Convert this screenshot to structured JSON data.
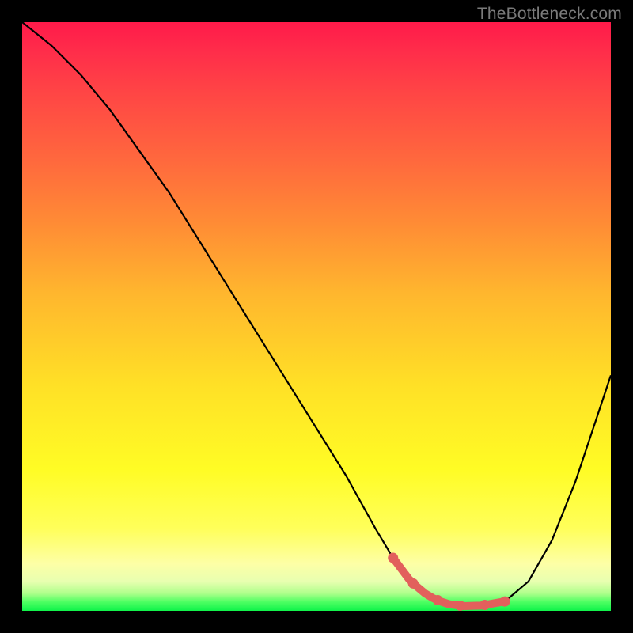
{
  "watermark": "TheBottleneck.com",
  "chart_data": {
    "type": "line",
    "title": "",
    "xlabel": "",
    "ylabel": "",
    "xlim": [
      0,
      100
    ],
    "ylim": [
      0,
      100
    ],
    "series": [
      {
        "name": "bottleneck-curve",
        "x": [
          0,
          5,
          10,
          15,
          20,
          25,
          30,
          35,
          40,
          45,
          50,
          55,
          60,
          63,
          66,
          69,
          72,
          75,
          78,
          82,
          86,
          90,
          94,
          98,
          100
        ],
        "y": [
          100,
          96,
          91,
          85,
          78,
          71,
          63,
          55,
          47,
          39,
          31,
          23,
          14,
          9,
          5,
          2.5,
          1.2,
          0.8,
          0.9,
          1.6,
          5,
          12,
          22,
          34,
          40
        ]
      }
    ],
    "highlight_range_x": [
      63,
      82
    ],
    "background_gradient": {
      "top": "#ff1a4a",
      "mid": "#ffe126",
      "bottom": "#10f34a"
    }
  }
}
